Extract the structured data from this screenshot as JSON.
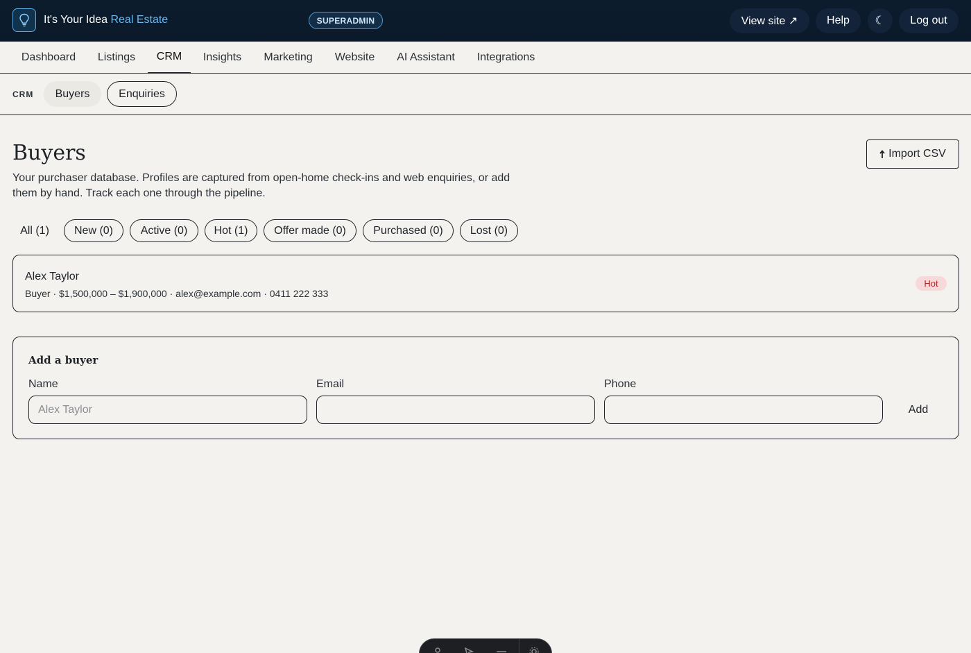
{
  "header": {
    "brand_main": "It's Your Idea",
    "brand_accent": "Real Estate",
    "role_badge": "SUPERADMIN",
    "view_site": "View site ↗",
    "help": "Help",
    "theme_toggle_icon": "moon-icon",
    "theme_toggle_glyph": "☾",
    "logout": "Log out"
  },
  "nav": {
    "items": [
      {
        "label": "Dashboard"
      },
      {
        "label": "Listings"
      },
      {
        "label": "CRM"
      },
      {
        "label": "Insights"
      },
      {
        "label": "Marketing"
      },
      {
        "label": "Website"
      },
      {
        "label": "AI Assistant"
      },
      {
        "label": "Integrations"
      }
    ],
    "active": "CRM"
  },
  "subnav": {
    "label": "CRM",
    "items": [
      {
        "label": "Buyers"
      },
      {
        "label": "Enquiries"
      }
    ]
  },
  "page": {
    "title": "Buyers",
    "description": "Your purchaser database. Profiles are captured from open-home check-ins and web enquiries, or add them by hand. Track each one through the pipeline.",
    "import_label": "Import CSV",
    "import_icon": "upload-arrow-icon"
  },
  "filters": [
    {
      "label": "All (1)"
    },
    {
      "label": "New (0)"
    },
    {
      "label": "Active (0)"
    },
    {
      "label": "Hot (1)"
    },
    {
      "label": "Offer made (0)"
    },
    {
      "label": "Purchased (0)"
    },
    {
      "label": "Lost (0)"
    }
  ],
  "buyers": [
    {
      "name": "Alex Taylor",
      "meta": "Buyer · $1,500,000 – $1,900,000 · alex@example.com · 0411 222 333",
      "status": "Hot"
    }
  ],
  "add_form": {
    "title": "Add a buyer",
    "name_label": "Name",
    "name_placeholder": "Alex Taylor",
    "email_label": "Email",
    "email_value": "",
    "phone_label": "Phone",
    "phone_value": "",
    "submit_label": "Add"
  },
  "colors": {
    "topbar_bg": "#0d1c2c",
    "accent": "#6ab8f0",
    "page_bg": "#f3f2ee",
    "hot_badge_bg": "#f6d9d8",
    "hot_badge_text": "#b1262b"
  }
}
